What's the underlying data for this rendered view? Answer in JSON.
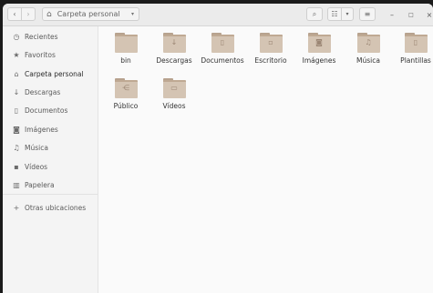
{
  "header": {
    "path_label": "Carpeta personal",
    "back_glyph": "‹",
    "forward_glyph": "›",
    "home_glyph": "⌂",
    "chevron_glyph": "▾",
    "search_glyph": "⌕",
    "view_glyph": "☷",
    "sort_glyph": "▾",
    "menu_glyph": "≡",
    "minimize_glyph": "–",
    "maximize_glyph": "□",
    "close_glyph": "×"
  },
  "sidebar": {
    "items": [
      {
        "label": "Recientes",
        "icon": "clock-icon",
        "glyph": "◷"
      },
      {
        "label": "Favoritos",
        "icon": "star-icon",
        "glyph": "★"
      },
      {
        "label": "Carpeta personal",
        "icon": "home-icon",
        "glyph": "⌂"
      },
      {
        "label": "Descargas",
        "icon": "download-icon",
        "glyph": "↓"
      },
      {
        "label": "Documentos",
        "icon": "document-icon",
        "glyph": "▯"
      },
      {
        "label": "Imágenes",
        "icon": "camera-icon",
        "glyph": "◙"
      },
      {
        "label": "Música",
        "icon": "music-icon",
        "glyph": "♫"
      },
      {
        "label": "Vídeos",
        "icon": "video-icon",
        "glyph": "▪"
      },
      {
        "label": "Papelera",
        "icon": "trash-icon",
        "glyph": "▥"
      },
      {
        "label": "Otras ubicaciones",
        "icon": "plus-icon",
        "glyph": "+"
      }
    ]
  },
  "files": [
    {
      "label": "bin",
      "icon": "folder-icon",
      "emblem": ""
    },
    {
      "label": "Descargas",
      "icon": "folder-download-icon",
      "emblem": "↓"
    },
    {
      "label": "Documentos",
      "icon": "folder-documents-icon",
      "emblem": "▯"
    },
    {
      "label": "Escritorio",
      "icon": "folder-desktop-icon",
      "emblem": "▫"
    },
    {
      "label": "Imágenes",
      "icon": "folder-pictures-icon",
      "emblem": "◙"
    },
    {
      "label": "Música",
      "icon": "folder-music-icon",
      "emblem": "♫"
    },
    {
      "label": "Plantillas",
      "icon": "folder-templates-icon",
      "emblem": "▯"
    },
    {
      "label": "Público",
      "icon": "folder-public-icon",
      "emblem": "⋲"
    },
    {
      "label": "Vídeos",
      "icon": "folder-videos-icon",
      "emblem": "▭"
    }
  ]
}
